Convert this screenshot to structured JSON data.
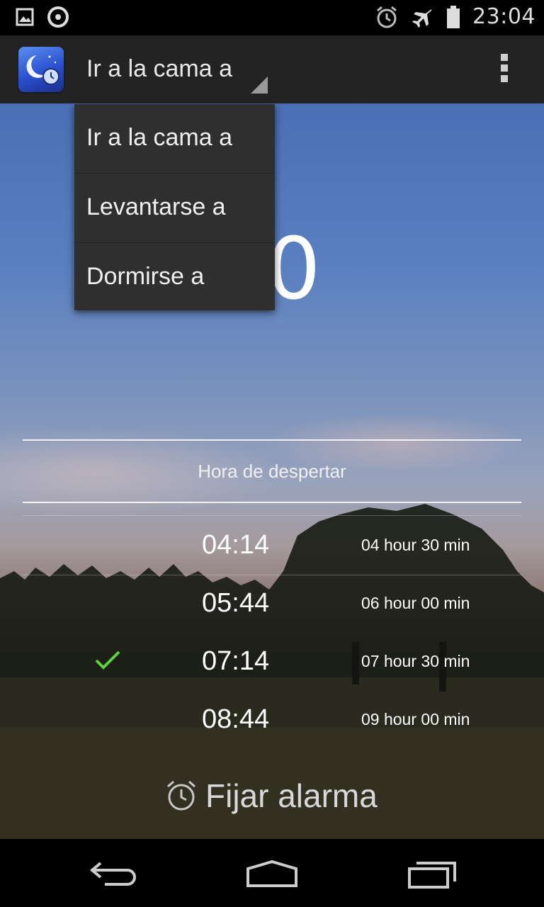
{
  "status_bar": {
    "time": "23:04",
    "left_icons": [
      "image-icon",
      "sync-icon"
    ],
    "right_icons": [
      "alarm-icon",
      "airplane-icon",
      "battery-icon"
    ]
  },
  "action_bar": {
    "app_icon": "moon-clock-app-icon",
    "spinner_label": "Ir a la cama a",
    "overflow_icon": "overflow-menu-icon"
  },
  "dropdown": {
    "items": [
      "Ir a la cama a",
      "Levantarse a",
      "Dormirse a"
    ]
  },
  "main": {
    "big_time_partial": "30",
    "section_title": "Hora de despertar",
    "rows": [
      {
        "time": "04:14",
        "duration": "04 hour 30 min",
        "selected": false
      },
      {
        "time": "05:44",
        "duration": "06 hour 00 min",
        "selected": false
      },
      {
        "time": "07:14",
        "duration": "07 hour 30 min",
        "selected": true
      },
      {
        "time": "08:44",
        "duration": "09 hour 00 min",
        "selected": false
      }
    ],
    "alarm_button_label": "Fijar alarma",
    "check_color": "#5fd13a"
  },
  "nav_bar": {
    "buttons": [
      "back-icon",
      "home-icon",
      "recents-icon"
    ]
  }
}
